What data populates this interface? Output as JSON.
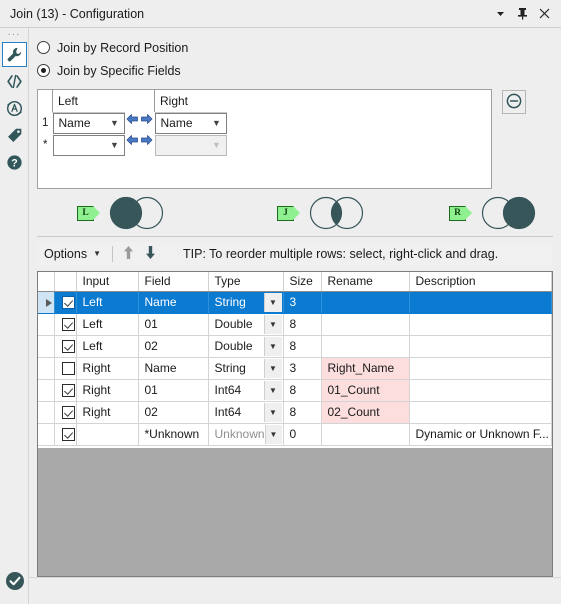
{
  "window": {
    "title": "Join (13) - Configuration",
    "controls": [
      {
        "name": "dropdown-caret",
        "icon": "caret-down-icon"
      },
      {
        "name": "pin",
        "icon": "pin-icon"
      },
      {
        "name": "close",
        "icon": "close-icon"
      }
    ]
  },
  "sidebar": {
    "items": [
      {
        "name": "configuration",
        "icon": "wrench-icon",
        "active": true
      },
      {
        "name": "xml-view",
        "icon": "code-icon",
        "active": false
      },
      {
        "name": "annotation-alteryx",
        "icon": "alteryx-circle-icon",
        "active": false
      },
      {
        "name": "label",
        "icon": "tag-icon",
        "active": false
      },
      {
        "name": "help",
        "icon": "question-icon",
        "active": false
      }
    ],
    "status_icon": "check-circle-icon"
  },
  "join_mode": {
    "options": [
      {
        "label": "Join by Record Position",
        "selected": false
      },
      {
        "label": "Join by Specific Fields",
        "selected": true
      }
    ]
  },
  "join_grid": {
    "headers": {
      "left": "Left",
      "right": "Right"
    },
    "rows": [
      {
        "index": "1",
        "left": "Name",
        "right": "Name",
        "disabled": false
      },
      {
        "index": "*",
        "left": "",
        "right": "",
        "disabled": true
      }
    ],
    "remove_button": "remove-circle-icon"
  },
  "venn": {
    "items": [
      {
        "tag": "L",
        "type": "left-only",
        "name": "venn-left"
      },
      {
        "tag": "J",
        "type": "inner",
        "name": "venn-join"
      },
      {
        "tag": "R",
        "type": "right-only",
        "name": "venn-right"
      }
    ]
  },
  "toolbar": {
    "options_label": "Options",
    "move_up": "arrow-up-icon",
    "move_down": "arrow-down-icon",
    "tip": "TIP: To reorder multiple rows: select, right-click and drag."
  },
  "fields_table": {
    "columns": [
      "",
      "",
      "Input",
      "Field",
      "Type",
      "Size",
      "Rename",
      "Description"
    ],
    "rows": [
      {
        "selected": true,
        "checked": true,
        "input": "Left",
        "field": "Name",
        "type": "String",
        "size": "3",
        "size_dim": false,
        "rename": "",
        "description": "",
        "type_dim": false,
        "desc_dim": false
      },
      {
        "selected": false,
        "checked": true,
        "input": "Left",
        "field": "01",
        "type": "Double",
        "size": "8",
        "size_dim": true,
        "rename": "",
        "description": "",
        "type_dim": false,
        "desc_dim": false
      },
      {
        "selected": false,
        "checked": true,
        "input": "Left",
        "field": "02",
        "type": "Double",
        "size": "8",
        "size_dim": true,
        "rename": "",
        "description": "",
        "type_dim": false,
        "desc_dim": false
      },
      {
        "selected": false,
        "checked": false,
        "input": "Right",
        "field": "Name",
        "type": "String",
        "size": "3",
        "size_dim": false,
        "rename": "Right_Name",
        "description": "",
        "type_dim": false,
        "desc_dim": false
      },
      {
        "selected": false,
        "checked": true,
        "input": "Right",
        "field": "01",
        "type": "Int64",
        "size": "8",
        "size_dim": true,
        "rename": "01_Count",
        "description": "",
        "type_dim": false,
        "desc_dim": false
      },
      {
        "selected": false,
        "checked": true,
        "input": "Right",
        "field": "02",
        "type": "Int64",
        "size": "8",
        "size_dim": true,
        "rename": "02_Count",
        "description": "",
        "type_dim": false,
        "desc_dim": false
      },
      {
        "selected": false,
        "checked": true,
        "input": "",
        "field": "*Unknown",
        "type": "Unknown",
        "size": "0",
        "size_dim": true,
        "rename": "",
        "description": "Dynamic or Unknown F...",
        "type_dim": true,
        "desc_dim": true
      }
    ]
  },
  "colors": {
    "accent_blue": "#0b7ad1",
    "teal": "#31575a",
    "tag_green": "#8ff08f",
    "rename_pink": "#fbdedd",
    "panel_gray": "#eeeeee"
  }
}
